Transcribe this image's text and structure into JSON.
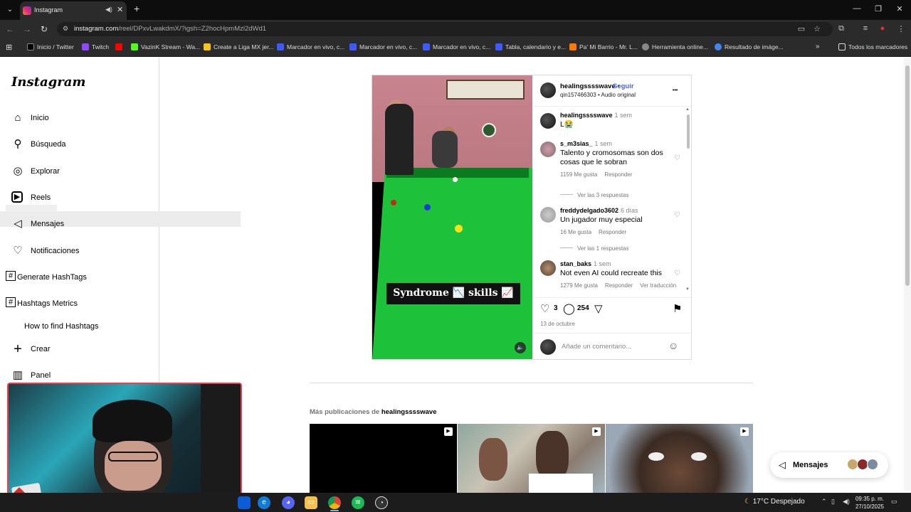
{
  "browser": {
    "tab_title": "Instagram",
    "url_prefix": "instagram.com",
    "url_rest": "/reel/DPxvLwakdmX/?igsh=Z2hocHpmMzl2dWd1",
    "bookmarks": [
      {
        "label": "Inicio / Twitter",
        "color": "#000000"
      },
      {
        "label": "Twitch",
        "color": "#9146ff"
      },
      {
        "label": "",
        "color": "#ff0000"
      },
      {
        "label": "VazinK Stream - Wa...",
        "color": "#53fc18"
      },
      {
        "label": "Create a Liga MX jer...",
        "color": "#f5c518"
      },
      {
        "label": "Marcador en vivo, c...",
        "color": "#3d5afe"
      },
      {
        "label": "Marcador en vivo, c...",
        "color": "#3d5afe"
      },
      {
        "label": "Marcador en vivo, c...",
        "color": "#3d5afe"
      },
      {
        "label": "Tabla, calendario y e...",
        "color": "#3d5afe"
      },
      {
        "label": "Pa' Mi Barrio - Mr. L...",
        "color": "#ff7a00"
      },
      {
        "label": "Herramienta online...",
        "color": "#888888"
      },
      {
        "label": "Resultado de imáge...",
        "color": "#4285f4"
      }
    ],
    "all_bookmarks": "Todos los marcadores",
    "more_bookmarks": "»"
  },
  "sidebar": {
    "logo": "Instagram",
    "items": [
      {
        "label": "Inicio",
        "icon": "⌂"
      },
      {
        "label": "Búsqueda",
        "icon": "⚲"
      },
      {
        "label": "Explorar",
        "icon": "◎"
      },
      {
        "label": "Reels",
        "icon": "▶"
      },
      {
        "label": "Mensajes",
        "icon": "◁"
      },
      {
        "label": "Notificaciones",
        "icon": "♡"
      },
      {
        "label": "Generate HashTags",
        "icon": "#"
      },
      {
        "label": "Hashtags Metrics",
        "icon": "#"
      },
      {
        "label": "How to find Hashtags",
        "icon": ""
      },
      {
        "label": "Crear",
        "icon": "+"
      },
      {
        "label": "Panel",
        "icon": "▥"
      }
    ]
  },
  "video": {
    "caption": "Syndrome 📉 skills 📈",
    "mute_icon": "🔈"
  },
  "post": {
    "username": "healingsssswave",
    "dot": " •",
    "follow": "Seguir",
    "subtitle": "qin157466303 • Audio original",
    "more": "•••",
    "comments": [
      {
        "user": "healingsssswave",
        "time": "1 sem",
        "text": "L😭",
        "meta": [],
        "replies": ""
      },
      {
        "user": "s_m3sias_",
        "time": "1 sem",
        "text": "Talento y cromosomas son dos cosas que le sobran",
        "meta": [
          "1159 Me gusta",
          "Responder"
        ],
        "replies": "Ver las 3 respuestas"
      },
      {
        "user": "freddydelgado3602",
        "time": "6 días",
        "text": "Un jugador muy especial",
        "meta": [
          "16 Me gusta",
          "Responder"
        ],
        "replies": "Ver las 1 respuestas"
      },
      {
        "user": "stan_baks",
        "time": "1 sem",
        "text": "Not even AI could recreate this",
        "meta": [
          "1279 Me gusta",
          "Responder",
          "Ver traducción"
        ],
        "replies": ""
      }
    ],
    "likes": "3",
    "comment_count": "254",
    "date": "13 de octubre",
    "add_comment_placeholder": "Añade un comentario..."
  },
  "more_posts": {
    "label": "Más publicaciones de",
    "user": "healingsssswave"
  },
  "messages_pill": {
    "label": "Mensajes"
  },
  "taskbar": {
    "weather": "17°C  Despejado",
    "time": "09:35 p. m.",
    "date": "27/10/2025"
  }
}
